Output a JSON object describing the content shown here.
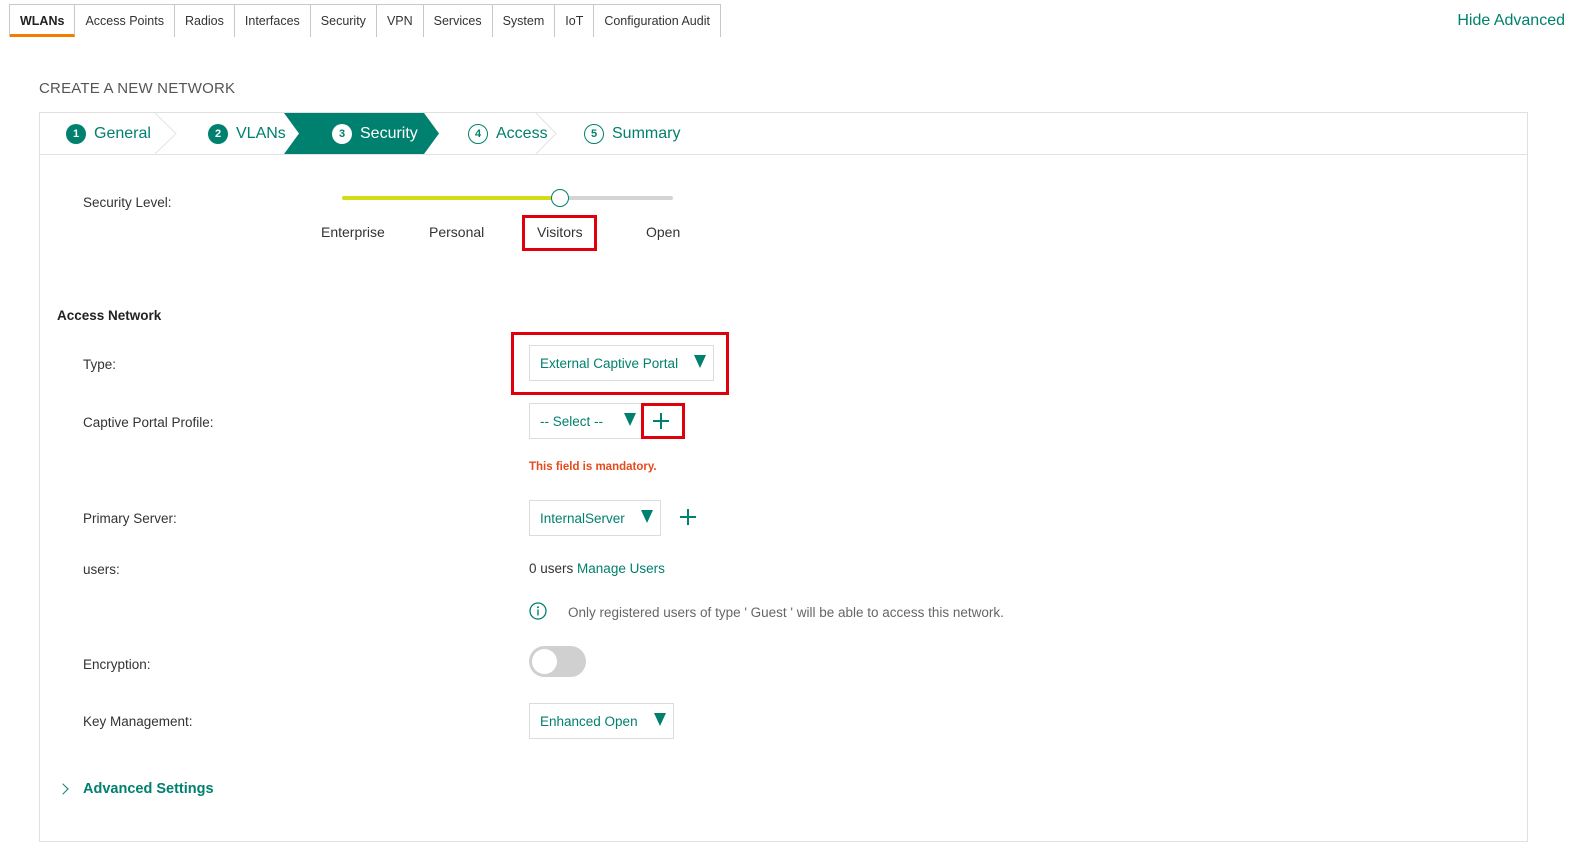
{
  "top_tabs": [
    "WLANs",
    "Access Points",
    "Radios",
    "Interfaces",
    "Security",
    "VPN",
    "Services",
    "System",
    "IoT",
    "Configuration Audit"
  ],
  "active_tab": "WLANs",
  "hide_advanced": "Hide Advanced",
  "create_title": "CREATE A NEW NETWORK",
  "wizard": {
    "steps": [
      {
        "num": "1",
        "label": "General"
      },
      {
        "num": "2",
        "label": "VLANs"
      },
      {
        "num": "3",
        "label": "Security"
      },
      {
        "num": "4",
        "label": "Access"
      },
      {
        "num": "5",
        "label": "Summary"
      }
    ],
    "active_step": "Security"
  },
  "security_level": {
    "label": "Security Level:",
    "options": [
      "Enterprise",
      "Personal",
      "Visitors",
      "Open"
    ],
    "selected": "Visitors",
    "slider_fraction": 0.66
  },
  "access_network": {
    "title": "Access Network",
    "type_label": "Type:",
    "type_value": "External Captive Portal",
    "captive_label": "Captive Portal Profile:",
    "captive_value": "-- Select --",
    "mandatory_msg": "This field is mandatory.",
    "primary_label": "Primary Server:",
    "primary_value": "InternalServer",
    "users_label": "users:",
    "users_count": "0 users",
    "manage_users": "Manage Users",
    "info_text": "Only registered users of type ' Guest ' will be able to access this network.",
    "encryption_label": "Encryption:",
    "encryption_on": false,
    "key_label": "Key Management:",
    "key_value": "Enhanced Open"
  },
  "advanced_settings": "Advanced Settings",
  "colors": {
    "accent": "#00806e",
    "highlight": "#e0000b",
    "slider_on": "#d6dc14",
    "tab_active": "#f57c00",
    "error": "#e8491d"
  }
}
